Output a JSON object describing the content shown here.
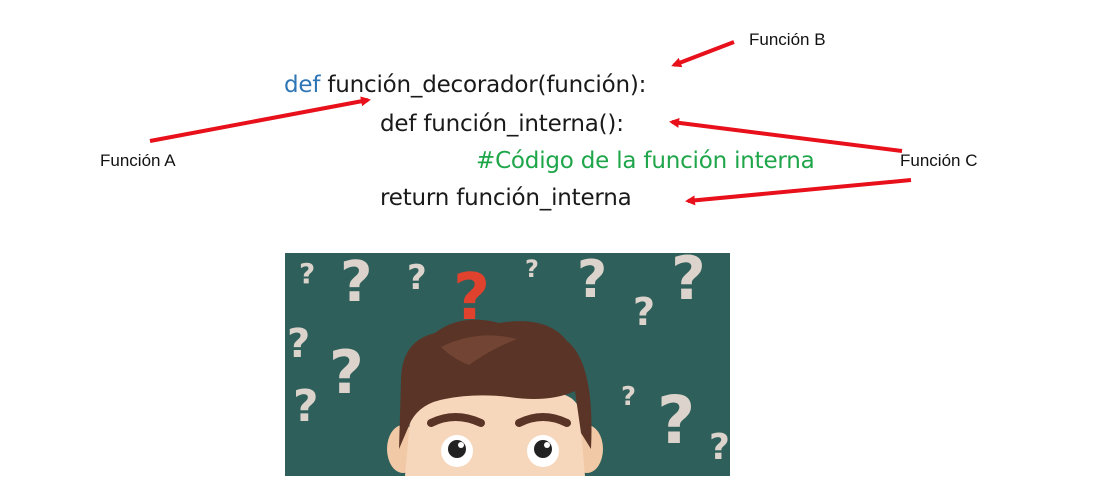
{
  "code": {
    "line1": {
      "keyword": "def",
      "rest": " función_decorador(función):"
    },
    "line2": "def función_interna():",
    "line3": "#Código de la función interna",
    "line4": "return función_interna"
  },
  "labels": {
    "a": "Función A",
    "b": "Función B",
    "c": "Función C"
  },
  "colors": {
    "keyword": "#2e75b6",
    "comment": "#1fa64a",
    "arrow": "#e8101a",
    "illustration_bg": "#2f5f5a"
  },
  "illustration": {
    "icons": [
      "question-mark-icon",
      "confused-person"
    ]
  }
}
